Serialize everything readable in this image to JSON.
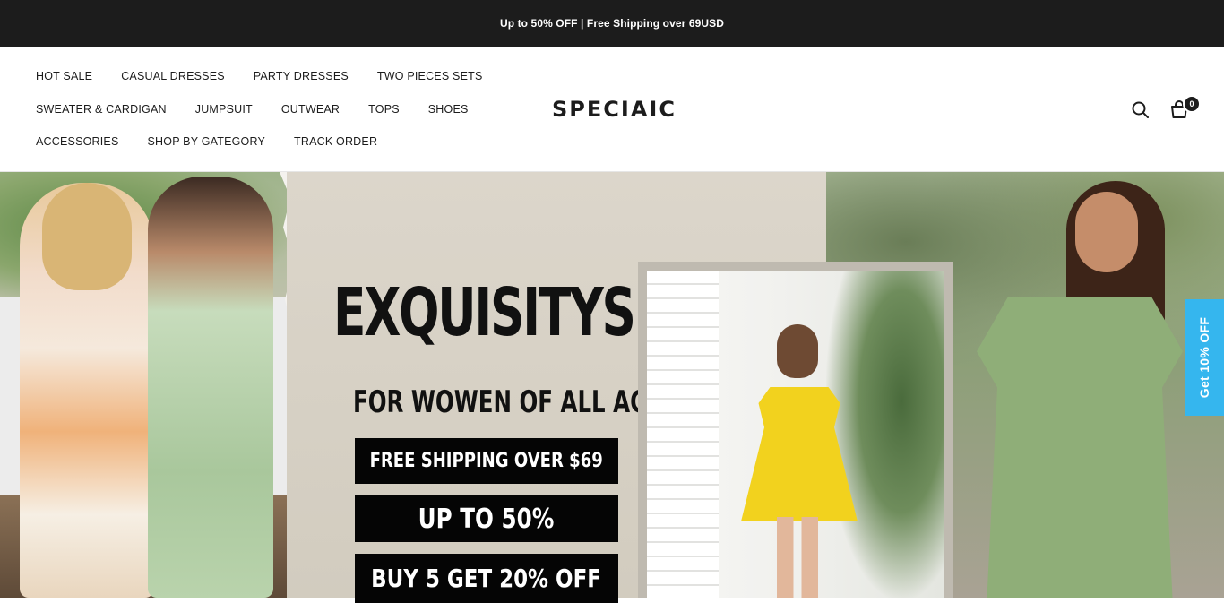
{
  "announcement": {
    "text": "Up to 50% OFF | Free Shipping over 69USD"
  },
  "nav": {
    "row1": [
      "HOT SALE",
      "CASUAL DRESSES",
      "PARTY DRESSES",
      "TWO PIECES SETS"
    ],
    "row2": [
      "SWEATER & CARDIGAN",
      "JUMPSUIT",
      "OUTWEAR",
      "TOPS",
      "SHOES"
    ],
    "row3": [
      "ACCESSORIES",
      "SHOP BY GATEGORY",
      "TRACK ORDER"
    ]
  },
  "logo": "SPECIAIC",
  "header_icons": {
    "search": "search-icon",
    "cart": "cart-icon"
  },
  "cart_count": "0",
  "hero": {
    "headline": "EXQUISITYS",
    "subline": "FOR WOWEN OF ALL AGES",
    "promos": [
      "FREE SHIPPING OVER $69",
      "UP TO 50%",
      "BUY 5 GET 20% OFF"
    ]
  },
  "side_tab": "Get 10% OFF",
  "colors": {
    "announcement_bg": "#1c1c1c",
    "side_tab_bg": "#35b6ee",
    "promo_box_bg": "#050505"
  }
}
